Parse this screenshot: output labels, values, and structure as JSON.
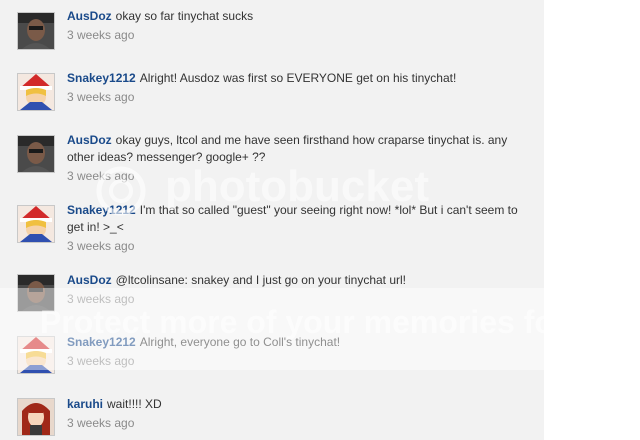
{
  "messages": [
    {
      "user": "AusDoz",
      "text": "okay so far tinychat sucks",
      "time": "3 weeks ago",
      "avatar": "masked-figure-avatar"
    },
    {
      "user": "Snakey1212",
      "text": "Alright! Ausdoz was first so EVERYONE get on his tinychat!",
      "time": "3 weeks ago",
      "avatar": "santa-hat-character-avatar"
    },
    {
      "user": "AusDoz",
      "text": "okay guys, ltcol and me have seen firsthand how craparse tinychat is. any other ideas? messenger? google+ ??",
      "time": "3 weeks ago",
      "avatar": "masked-figure-avatar"
    },
    {
      "user": "Snakey1212",
      "text": "I'm that so called \"guest\" your seeing right now! *lol* But i can't seem to get in! >_<",
      "time": "3 weeks ago",
      "avatar": "santa-hat-character-avatar"
    },
    {
      "user": "AusDoz",
      "text": "@ltcolinsane: snakey and I just go on your tinychat url!",
      "time": "3 weeks ago",
      "avatar": "masked-figure-avatar"
    },
    {
      "user": "Snakey1212",
      "text": "Alright, everyone go to Coll's tinychat!",
      "time": "3 weeks ago",
      "avatar": "santa-hat-character-avatar"
    },
    {
      "user": "karuhi",
      "text": "wait!!!! XD",
      "time": "3 weeks ago",
      "avatar": "red-haired-character-avatar"
    }
  ],
  "watermark": {
    "brand": "photobucket",
    "tagline": "Protect more of your memories for less!"
  }
}
